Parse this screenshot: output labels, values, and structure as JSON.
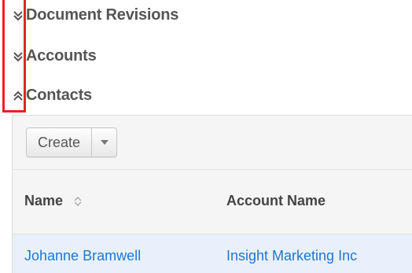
{
  "subpanels": [
    {
      "title": "Document Revisions",
      "state": "collapsed",
      "icon": "double-chevron-down-icon"
    },
    {
      "title": "Accounts",
      "state": "collapsed",
      "icon": "double-chevron-down-icon"
    },
    {
      "title": "Contacts",
      "state": "expanded",
      "icon": "double-chevron-up-icon"
    }
  ],
  "toolbar": {
    "create_label": "Create",
    "caret_icon": "caret-down-icon"
  },
  "list": {
    "columns": [
      {
        "label": "Name",
        "sortable": true
      },
      {
        "label": "Account Name",
        "sortable": false
      }
    ],
    "rows": [
      {
        "name": "Johanne Bramwell",
        "account": "Insight Marketing Inc"
      }
    ]
  },
  "colors": {
    "highlight": "#e8231f",
    "link": "#1f76d2",
    "header_text": "#555555",
    "row_highlight": "#e8f1fb"
  }
}
